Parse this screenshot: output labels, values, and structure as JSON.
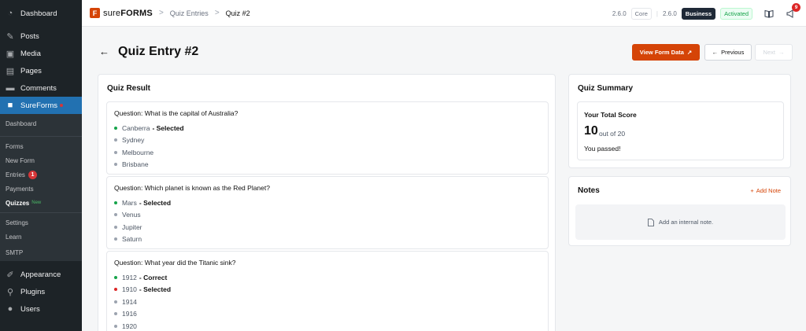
{
  "sidebar": {
    "dashboard": "Dashboard",
    "posts": "Posts",
    "media": "Media",
    "pages": "Pages",
    "comments": "Comments",
    "sureforms": "SureForms",
    "sub": {
      "dashboard": "Dashboard",
      "forms": "Forms",
      "new_form": "New Form",
      "entries": "Entries",
      "entries_badge": "1",
      "payments": "Payments",
      "quizzes": "Quizzes",
      "quizzes_new": "New",
      "settings": "Settings",
      "learn": "Learn",
      "smtp": "SMTP"
    },
    "appearance": "Appearance",
    "plugins": "Plugins",
    "users": "Users"
  },
  "topbar": {
    "logo_mark": "F",
    "logo_prefix": "sure",
    "logo_suffix": "FORMS",
    "crumb_sep": ">",
    "crumb1": "Quiz Entries",
    "crumb2": "Quiz #2",
    "version1": "2.6.0",
    "core": "Core",
    "divider": "|",
    "version2": "2.6.0",
    "business": "Business",
    "activated": "Activated",
    "notif_count": "9"
  },
  "header": {
    "title": "Quiz Entry #2",
    "view_form_data": "View Form Data",
    "previous": "Previous",
    "next": "Next"
  },
  "quiz_result": {
    "title": "Quiz Result",
    "questions": [
      {
        "text": "Question: What is the capital of Australia?",
        "options": [
          {
            "label": "Canberra",
            "tag": "- Selected",
            "bullet": "green"
          },
          {
            "label": "Sydney",
            "tag": "",
            "bullet": "grey"
          },
          {
            "label": "Melbourne",
            "tag": "",
            "bullet": "grey"
          },
          {
            "label": "Brisbane",
            "tag": "",
            "bullet": "grey"
          }
        ]
      },
      {
        "text": "Question: Which planet is known as the Red Planet?",
        "options": [
          {
            "label": "Mars",
            "tag": "- Selected",
            "bullet": "green"
          },
          {
            "label": "Venus",
            "tag": "",
            "bullet": "grey"
          },
          {
            "label": "Jupiter",
            "tag": "",
            "bullet": "grey"
          },
          {
            "label": "Saturn",
            "tag": "",
            "bullet": "grey"
          }
        ]
      },
      {
        "text": "Question: What year did the Titanic sink?",
        "options": [
          {
            "label": "1912",
            "tag": "- Correct",
            "bullet": "green"
          },
          {
            "label": "1910",
            "tag": "- Selected",
            "bullet": "red"
          },
          {
            "label": "1914",
            "tag": "",
            "bullet": "grey"
          },
          {
            "label": "1916",
            "tag": "",
            "bullet": "grey"
          },
          {
            "label": "1920",
            "tag": "",
            "bullet": "grey"
          }
        ]
      }
    ]
  },
  "quiz_summary": {
    "title": "Quiz Summary",
    "score_label": "Your Total Score",
    "score": "10",
    "out_of": "out of 20",
    "status": "You passed!"
  },
  "notes": {
    "title": "Notes",
    "add_note": "Add Note",
    "placeholder": "Add an internal note."
  },
  "colors": {
    "brand": "#d54407",
    "sidebar_bg": "#1d2327",
    "active": "#2271b1",
    "correct": "#16a34a",
    "wrong": "#dc2626"
  }
}
